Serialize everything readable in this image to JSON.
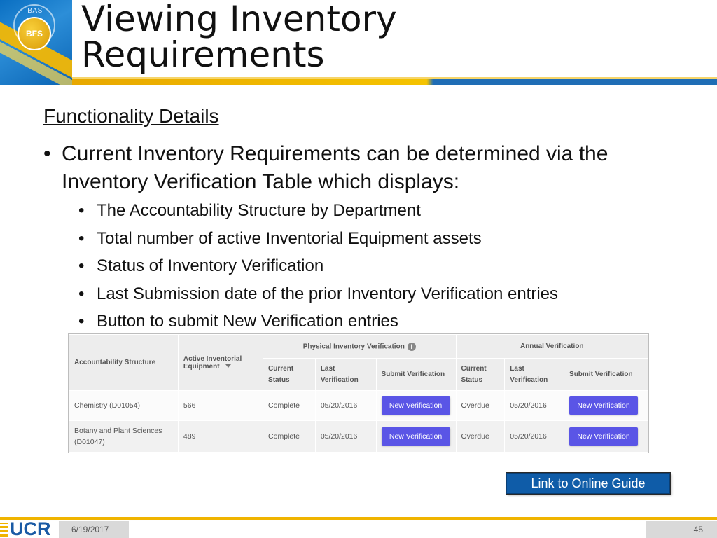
{
  "header": {
    "logo_top_text": "BAS",
    "logo_text": "BFS",
    "title": "Viewing Inventory\nRequirements"
  },
  "content": {
    "subheading": "Functionality Details",
    "main_bullet": "Current Inventory Requirements can be determined via the Inventory Verification Table which displays:",
    "sub_bullets": [
      "The Accountability Structure by Department",
      "Total number of active Inventorial Equipment assets",
      "Status of Inventory Verification",
      "Last Submission date of the prior Inventory Verification entries",
      "Button to submit New Verification entries"
    ]
  },
  "table": {
    "headers": {
      "accountability": "Accountability Structure",
      "active_equipment": "Active Inventorial Equipment",
      "physical_group": "Physical Inventory Verification",
      "annual_group": "Annual Verification",
      "current_status": "Current Status",
      "last_verification": "Last Verification",
      "submit_verification": "Submit Verification"
    },
    "rows": [
      {
        "structure": "Chemistry (D01054)",
        "active": "566",
        "phys_status": "Complete",
        "phys_last": "05/20/2016",
        "phys_button": "New Verification",
        "annual_status": "Overdue",
        "annual_last": "05/20/2016",
        "annual_button": "New Verification"
      },
      {
        "structure": "Botany and Plant Sciences (D01047)",
        "active": "489",
        "phys_status": "Complete",
        "phys_last": "05/20/2016",
        "phys_button": "New Verification",
        "annual_status": "Overdue",
        "annual_last": "05/20/2016",
        "annual_button": "New Verification"
      }
    ],
    "colors": {
      "complete": "#2db84a",
      "overdue": "#e2443b",
      "button": "#5a55e6"
    }
  },
  "guide_link": "Link to Online Guide",
  "footer": {
    "logo_text": "UCR",
    "date": "6/19/2017",
    "page_number": "45"
  },
  "theme": {
    "blue": "#0a6fc2",
    "gold": "#f0b400"
  }
}
